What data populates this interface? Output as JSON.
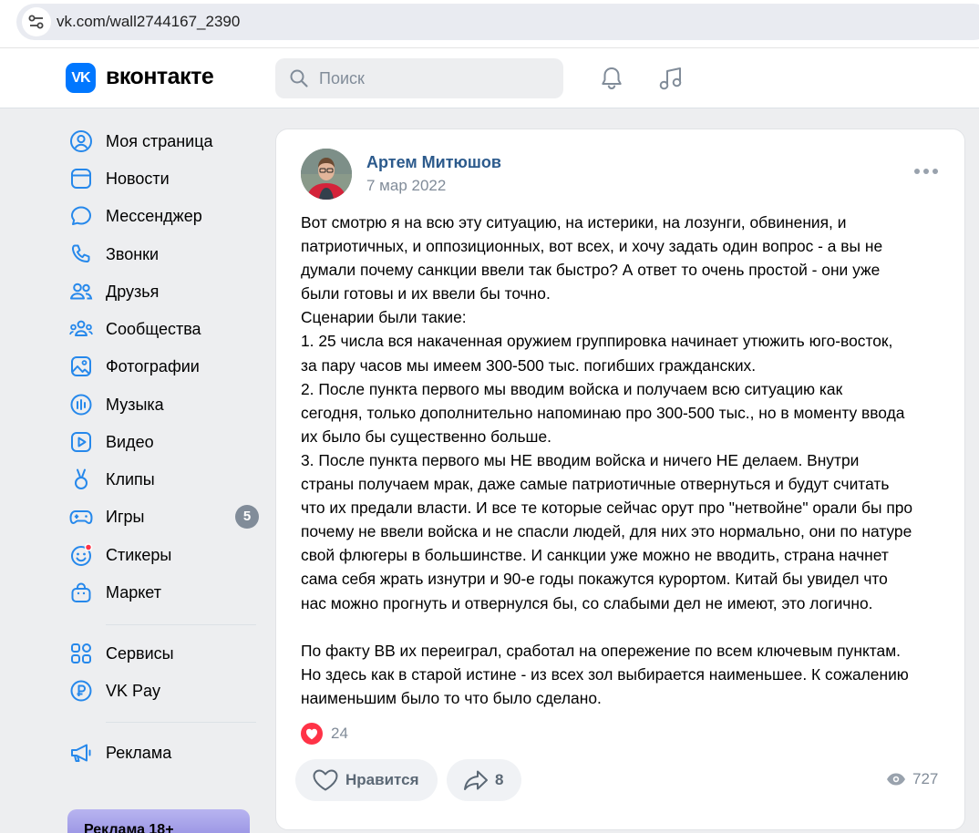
{
  "browser": {
    "url": "vk.com/wall2744167_2390"
  },
  "header": {
    "logo_mark": "VK",
    "logo_text": "вконтакте",
    "search_placeholder": "Поиск",
    "icons": [
      "search-icon",
      "bell-icon",
      "music-icon"
    ]
  },
  "sidebar": {
    "items": [
      {
        "label": "Моя страница",
        "icon": "user-circle-icon"
      },
      {
        "label": "Новости",
        "icon": "newsfeed-icon"
      },
      {
        "label": "Мессенджер",
        "icon": "message-icon"
      },
      {
        "label": "Звонки",
        "icon": "phone-icon"
      },
      {
        "label": "Друзья",
        "icon": "friends-icon"
      },
      {
        "label": "Сообщества",
        "icon": "communities-icon"
      },
      {
        "label": "Фотографии",
        "icon": "photos-icon"
      },
      {
        "label": "Музыка",
        "icon": "music-icon"
      },
      {
        "label": "Видео",
        "icon": "video-icon"
      },
      {
        "label": "Клипы",
        "icon": "clips-icon"
      },
      {
        "label": "Игры",
        "icon": "games-icon",
        "badge": "5"
      },
      {
        "label": "Стикеры",
        "icon": "stickers-icon"
      },
      {
        "label": "Маркет",
        "icon": "market-icon"
      },
      {
        "label": "Сервисы",
        "icon": "services-icon"
      },
      {
        "label": "VK Pay",
        "icon": "vkpay-icon"
      },
      {
        "label": "Реклама",
        "icon": "megaphone-icon"
      }
    ],
    "ad_label": "Реклама 18+"
  },
  "post": {
    "author": "Артем Митюшов",
    "date": "7 мар 2022",
    "lines": [
      "Вот смотрю я на всю эту ситуацию, на истерики, на лозунги, обвинения, и",
      "патриотичных, и оппозиционных, вот всех, и хочу задать один вопрос - а вы не",
      "думали почему санкции ввели так быстро? А ответ то очень простой - они уже",
      "были готовы и их ввели бы точно.",
      "Сценарии были такие:",
      "1. 25 числа вся накаченная оружием группировка начинает утюжить юго-восток,",
      "за пару часов мы имеем 300-500 тыс. погибших гражданских.",
      "2. После пункта первого мы вводим войска и получаем всю ситуацию как",
      "сегодня, только дополнительно напоминаю про 300-500 тыс., но в моменту ввода",
      "их было бы существенно больше.",
      "3. После пункта первого мы НЕ вводим войска и ничего НЕ делаем. Внутри",
      "страны получаем мрак, даже самые патриотичные отвернуться и будут считать",
      "что их предали власти. И все те которые сейчас орут про \"нетвойне\" орали бы про",
      "почему не ввели войска и не спасли людей, для них это нормально, они по натуре",
      "свой флюгеры в большинстве. И санкции уже можно не вводить, страна начнет",
      "сама себя жрать изнутри и 90-е годы покажутся курортом. Китай бы увидел что",
      "нас можно прогнуть и отвернулся бы, со слабыми дел не имеют, это логично.",
      "",
      "По факту ВВ их переиграл, сработал на опережение по всем ключевым пунктам.",
      "Но здесь как в старой истине - из всех зол выбирается наименьшее. К сожалению",
      "наименьшим было то что было сделано."
    ],
    "reaction_count": "24",
    "like_label": "Нравится",
    "share_count": "8",
    "views": "727"
  },
  "colors": {
    "accent": "#0077ff",
    "link": "#2c5a8c",
    "secondary": "#818c99",
    "background": "#edeef0",
    "heart": "#ff3347"
  }
}
